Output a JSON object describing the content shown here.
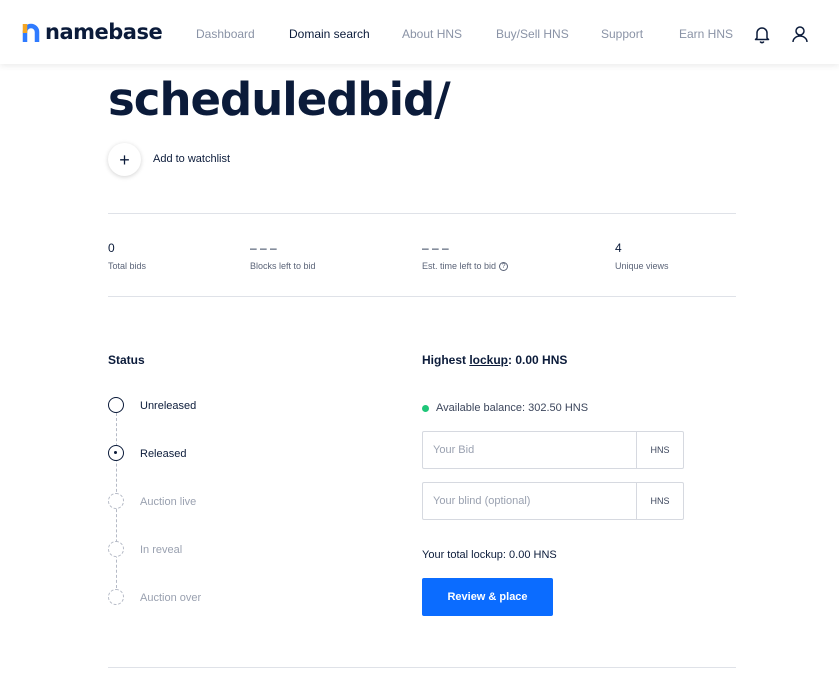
{
  "header": {
    "brand": "namebase",
    "nav": [
      {
        "label": "Dashboard"
      },
      {
        "label": "Domain search"
      },
      {
        "label": "About HNS"
      },
      {
        "label": "Buy/Sell HNS"
      },
      {
        "label": "Support"
      },
      {
        "label": "Earn HNS"
      }
    ],
    "icons": [
      "bell-icon",
      "user-icon"
    ]
  },
  "domain": {
    "name": "scheduledbid/",
    "watchlist_label": "Add to watchlist",
    "watchlist_icon": "+"
  },
  "stats": [
    {
      "value": "0",
      "label": "Total bids"
    },
    {
      "value": "– – –",
      "label": "Blocks left to bid"
    },
    {
      "value": "– – –",
      "label": "Est. time left to bid",
      "help": "?"
    },
    {
      "value": "4",
      "label": "Unique views"
    }
  ],
  "status": {
    "title": "Status",
    "steps": [
      {
        "label": "Unreleased",
        "state": "done"
      },
      {
        "label": "Released",
        "state": "current"
      },
      {
        "label": "Auction live",
        "state": "pending"
      },
      {
        "label": "In reveal",
        "state": "pending"
      },
      {
        "label": "Auction over",
        "state": "pending"
      }
    ]
  },
  "bid": {
    "title_prefix": "Highest ",
    "title_link": "lockup",
    "title_suffix": ": 0.00 HNS",
    "balance": "Available balance: 302.50 HNS",
    "bid_placeholder": "Your Bid",
    "bid_value": "",
    "blind_placeholder": "Your blind (optional)",
    "blind_value": "",
    "unit": "HNS",
    "total": "Your total lockup: 0.00 HNS",
    "button": "Review & place"
  },
  "colors": {
    "primary": "#0b6cff",
    "text": "#0b1b3a",
    "balance_dot": "#1fc679",
    "logo_orange": "#f5a623",
    "logo_blue": "#2f7bff"
  }
}
